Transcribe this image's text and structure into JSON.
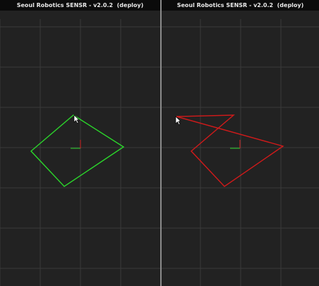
{
  "windows": [
    {
      "title": "Seoul Robotics SENSR - v2.0.2  (deploy)",
      "shape_color": "#2bd62b",
      "axis_x_color": "#2bd62b",
      "axis_y_color": "#d12020",
      "cursor": "arrow-cursor-icon"
    },
    {
      "title": "Seoul Robotics SENSR - v2.0.2  (deploy)",
      "shape_color": "#d11a1a",
      "axis_x_color": "#2bd62b",
      "axis_y_color": "#d12020",
      "cursor": "arrow-cursor-icon"
    }
  ],
  "colors": {
    "grid": "#3a3a3a",
    "background": "#222222",
    "titlebar": "#0b0b0b",
    "divider": "#8a8a8a"
  }
}
